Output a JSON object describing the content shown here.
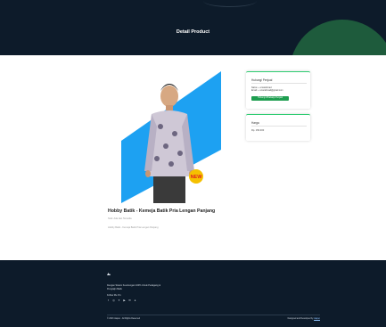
{
  "header": {
    "title": "Detail Product"
  },
  "product": {
    "title": "Hobby Batik - Kemeja Batik Pria Lengan Panjang",
    "subtitle": "Stok: Ada dan Tersedia",
    "description": "Hobby Batik - Kemeja Batik Pria Lengan Panjang",
    "badge": "NEW"
  },
  "seller_card": {
    "title": "Hubungi Penjual",
    "name_line": "Nama: + umarahmad",
    "email_line": "Email: + umarahmad@gmail.com",
    "wa_button": "Hubungi Whatsapp Penjual"
  },
  "price_card": {
    "title": "Harga",
    "price": "Rp. 150.000"
  },
  "footer": {
    "desc_line1": "Dengan Sistem Keuntungan 100% Untuk Pedagang &",
    "desc_line2": "Pengrajin Batik",
    "follow": "Follow Me On:",
    "socials": [
      "facebook-icon",
      "instagram-icon",
      "twitter-icon",
      "youtube-icon",
      "email-icon",
      "whatsapp-icon"
    ],
    "copyright": "© 2023 Jasper - All Rights Reserved",
    "designed_prefix": "Designed and Developed by ",
    "designed_link": "Jasper"
  },
  "colors": {
    "navy": "#0d1b2a",
    "green_accent": "#1e5b3c",
    "button_green": "#1e9e50",
    "card_border": "#2ecc71",
    "image_blue": "#1da1f2"
  }
}
